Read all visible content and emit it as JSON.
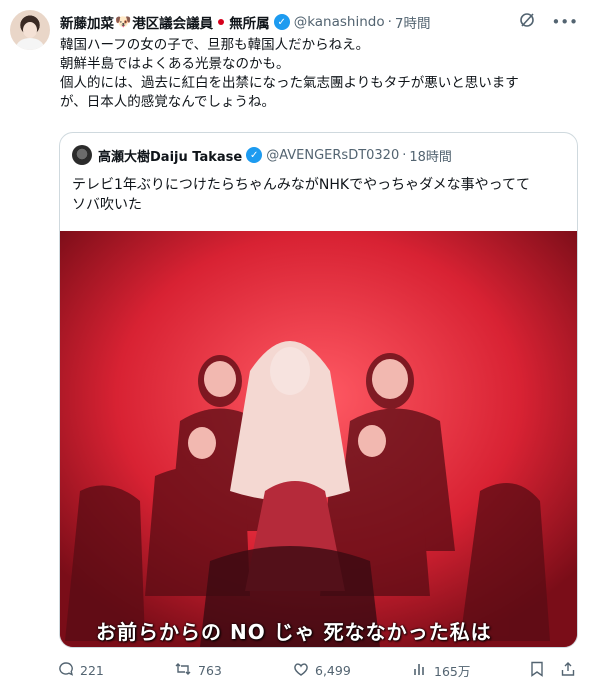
{
  "post": {
    "author": {
      "name": "新藤加菜",
      "name_suffix": "港区議会議員",
      "affiliation": "無所属",
      "handle": "@kanashindo",
      "time": "7時間"
    },
    "text": "韓国ハーフの女の子で、旦那も韓国人だからねえ。\n朝鮮半島ではよくある光景なのかも。\n個人的には、過去に紅白を出禁になった氣志團よりもタチが悪いと思います\nが、日本人的感覚なんでしょうね。",
    "icons": {
      "grok": "grok-icon",
      "more": "more-icon",
      "verified": "verified-badge-icon",
      "dog": "dog-emoji-icon",
      "flag": "japan-flag-icon"
    },
    "colors": {
      "verified": "#1d9bf0",
      "muted": "#536471",
      "media_bg": "#c81e2d"
    }
  },
  "quote": {
    "author": {
      "name": "高瀬大樹Daiju Takase",
      "handle": "@AVENGERsDT0320",
      "time": "18時間"
    },
    "text": "テレビ1年ぶりにつけたらちゃんみながNHKでやっちゃダメな事やってて\nソバ吹いた",
    "media": {
      "subtitle": "お前らからの NO じゃ 死ななかった私は"
    }
  },
  "actions": {
    "replies": "221",
    "reposts": "763",
    "likes": "6,499",
    "views": "165万"
  }
}
